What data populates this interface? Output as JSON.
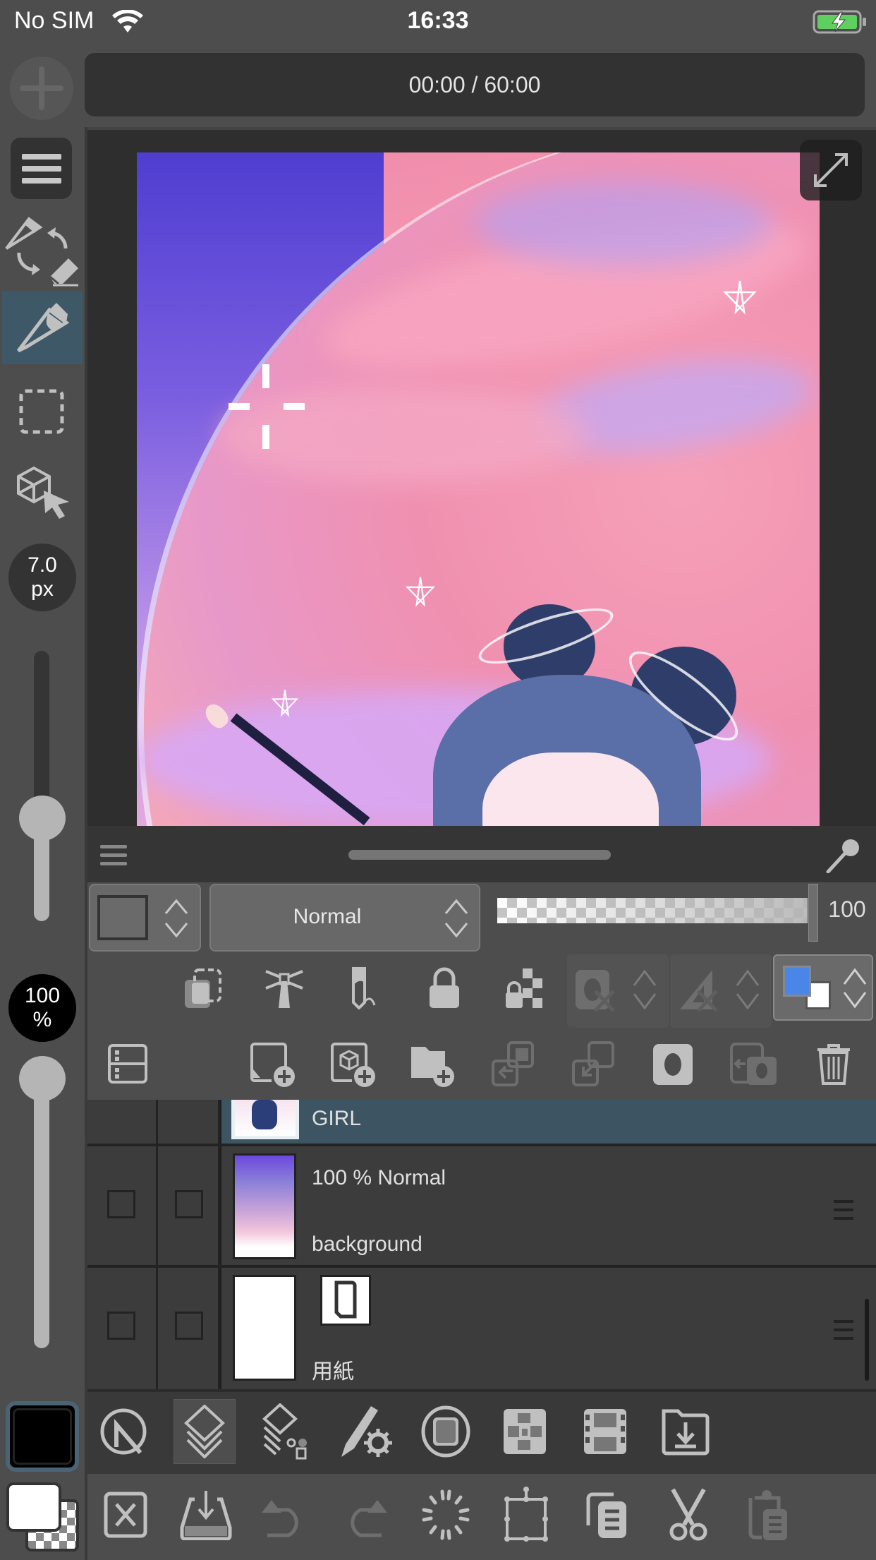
{
  "status_bar": {
    "carrier": "No SIM",
    "time": "16:33",
    "battery": "charging"
  },
  "timer": {
    "text": "00:00 / 60:00"
  },
  "sidebar": {
    "tools": [
      {
        "name": "menu",
        "icon": "hamburger-icon"
      },
      {
        "name": "pen-eraser-switch",
        "icon": "swap-pen-eraser-icon"
      },
      {
        "name": "pen",
        "icon": "pen-icon",
        "active": true
      },
      {
        "name": "selection",
        "icon": "marquee-select-icon"
      },
      {
        "name": "3d-object",
        "icon": "cube-cursor-icon"
      }
    ],
    "brush_size": {
      "value": "7.0",
      "unit": "px",
      "slider_fraction": 0.38
    },
    "brush_opacity": {
      "value": "100",
      "unit": "%",
      "slider_fraction": 1.0
    },
    "main_color": "#000000",
    "sub_color": "#ffffff"
  },
  "canvas": {
    "expand_button": "expand-icon"
  },
  "layer_panel": {
    "header": {
      "menu_icon": "hamburger-icon",
      "pin_icon": "pin-icon"
    },
    "properties": {
      "blend_mode": "Normal",
      "opacity": "100",
      "opacity_fraction": 1.0
    },
    "property_icons": [
      "clipping-icon",
      "reference-layer-icon",
      "draft-layer-icon",
      "lock-icon",
      "lock-transparent-icon",
      "mask-disabled-icon",
      "ruler-disabled-icon",
      "layer-color-icon"
    ],
    "layer_color": {
      "main": "#4a86e8",
      "sub": "#ffffff"
    },
    "action_icons": [
      "layer-property-icon",
      "new-raster-layer-icon",
      "new-3d-layer-icon",
      "new-folder-icon",
      "transfer-down-icon",
      "merge-down-icon",
      "create-mask-icon",
      "apply-mask-icon",
      "delete-icon"
    ],
    "layers": [
      {
        "name": "GIRL",
        "selected": true,
        "info": ""
      },
      {
        "name": "background",
        "info": "100 % Normal",
        "selected": false
      },
      {
        "name": "用紙",
        "info": "",
        "selected": false,
        "paper": true
      }
    ]
  },
  "bottom_bar_1": [
    {
      "icon": "navigator-icon",
      "active": false
    },
    {
      "icon": "layers-icon",
      "active": true
    },
    {
      "icon": "layer-property-icon",
      "active": false
    },
    {
      "icon": "tool-property-icon",
      "active": false
    },
    {
      "icon": "color-circle-icon",
      "active": false
    },
    {
      "icon": "material-icon",
      "active": false
    },
    {
      "icon": "timeline-icon",
      "active": false
    },
    {
      "icon": "import-icon",
      "active": false
    }
  ],
  "bottom_bar_2": [
    {
      "icon": "clear-icon",
      "enabled": true
    },
    {
      "icon": "fill-icon",
      "enabled": true
    },
    {
      "icon": "undo-icon",
      "enabled": false
    },
    {
      "icon": "redo-icon",
      "enabled": false
    },
    {
      "icon": "loading-icon",
      "enabled": true
    },
    {
      "icon": "transform-icon",
      "enabled": true
    },
    {
      "icon": "copy-icon",
      "enabled": true
    },
    {
      "icon": "cut-icon",
      "enabled": true
    },
    {
      "icon": "paste-icon",
      "enabled": false
    }
  ]
}
